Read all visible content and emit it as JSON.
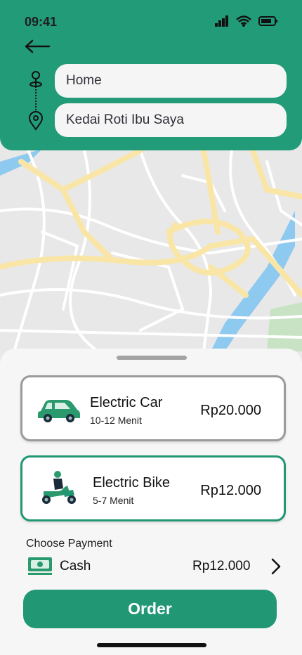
{
  "status_bar": {
    "time": "09:41"
  },
  "route": {
    "origin_value": "Home",
    "destination_value": "Kedai Roti Ibu Saya"
  },
  "rides": [
    {
      "name": "Electric Car",
      "eta": "10-12 Menit",
      "price": "Rp20.000",
      "icon": "car-icon"
    },
    {
      "name": "Electric Bike",
      "eta": "5-7 Menit",
      "price": "Rp12.000",
      "icon": "scooter-icon"
    }
  ],
  "payment": {
    "label": "Choose Payment",
    "method": "Cash",
    "price": "Rp12.000"
  },
  "order_button": "Order",
  "colors": {
    "brand": "#229b78",
    "selected_border": "#239674",
    "unselected_border": "#9a9a9a"
  }
}
